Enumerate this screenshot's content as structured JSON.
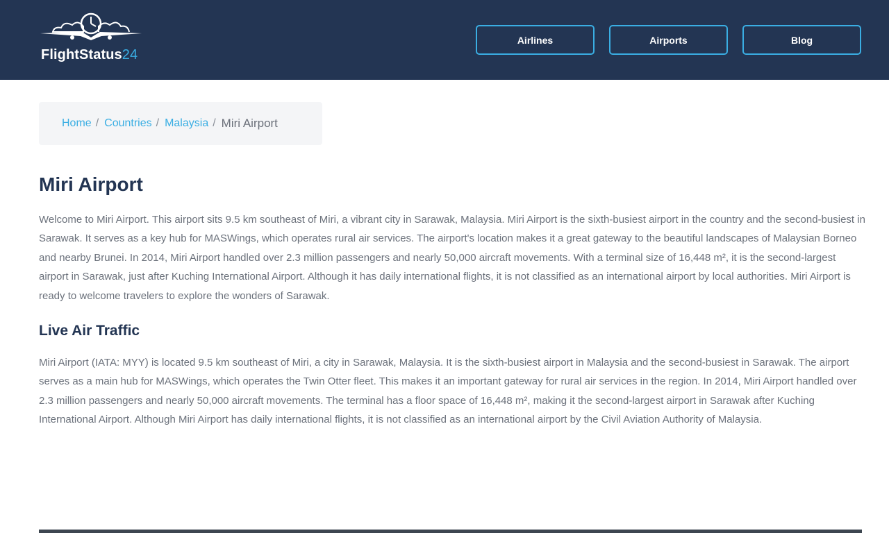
{
  "header": {
    "logo": {
      "name": "FlightStatus",
      "accent": "24"
    },
    "nav": {
      "airlines": "Airlines",
      "airports": "Airports",
      "blog": "Blog"
    }
  },
  "breadcrumb": {
    "home": "Home",
    "countries": "Countries",
    "country": "Malaysia",
    "current": "Miri Airport",
    "separator": "/"
  },
  "page": {
    "title": "Miri Airport",
    "intro": "Welcome to Miri Airport. This airport sits 9.5 km southeast of Miri, a vibrant city in Sarawak, Malaysia. Miri Airport is the sixth-busiest airport in the country and the second-busiest in Sarawak. It serves as a key hub for MASWings, which operates rural air services. The airport's location makes it a great gateway to the beautiful landscapes of Malaysian Borneo and nearby Brunei. In 2014, Miri Airport handled over 2.3 million passengers and nearly 50,000 aircraft movements. With a terminal size of 16,448 m², it is the second-largest airport in Sarawak, just after Kuching International Airport. Although it has daily international flights, it is not classified as an international airport by local authorities. Miri Airport is ready to welcome travelers to explore the wonders of Sarawak.",
    "section_title": "Live Air Traffic",
    "section_text": "Miri Airport (IATA: MYY) is located 9.5 km southeast of Miri, a city in Sarawak, Malaysia. It is the sixth-busiest airport in Malaysia and the second-busiest in Sarawak. The airport serves as a main hub for MASWings, which operates the Twin Otter fleet. This makes it an important gateway for rural air services in the region. In 2014, Miri Airport handled over 2.3 million passengers and nearly 50,000 aircraft movements. The terminal has a floor space of 16,448 m², making it the second-largest airport in Sarawak after Kuching International Airport. Although Miri Airport has daily international flights, it is not classified as an international airport by the Civil Aviation Authority of Malaysia."
  },
  "colors": {
    "header_bg": "#233553",
    "accent": "#3aaee3",
    "heading": "#233553",
    "body_text": "#6b717b",
    "breadcrumb_bg": "#f4f5f7"
  }
}
